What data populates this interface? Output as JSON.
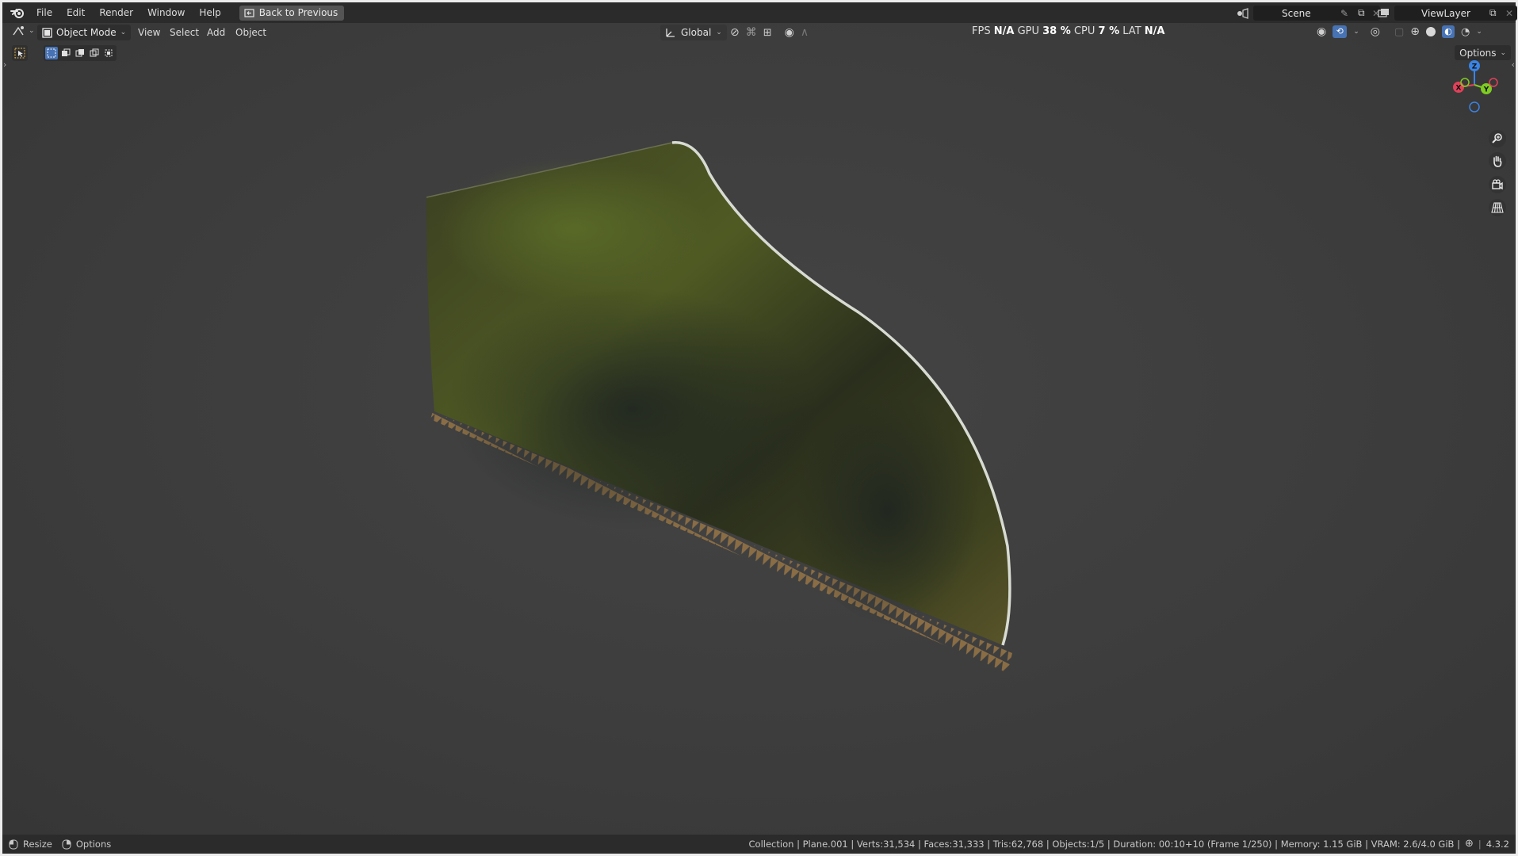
{
  "menubar": {
    "items": [
      "File",
      "Edit",
      "Render",
      "Window",
      "Help"
    ],
    "back_button": "Back to Previous",
    "scene_name": "Scene",
    "view_layer": "ViewLayer"
  },
  "viewport_header": {
    "mode": "Object Mode",
    "menus": [
      "View",
      "Select",
      "Add",
      "Object"
    ],
    "transform_orientation": "Global",
    "options_label": "Options"
  },
  "perf": {
    "fps_label": "FPS",
    "fps_value": "N/A",
    "gpu_label": "GPU",
    "gpu_value": "38 %",
    "cpu_label": "CPU",
    "cpu_value": "7 %",
    "lat_label": "LAT",
    "lat_value": "N/A"
  },
  "gizmo": {
    "z": "Z",
    "y": "Y",
    "x": "X"
  },
  "statusbar": {
    "resize_label": "Resize",
    "options_label": "Options",
    "info": "Collection | Plane.001 | Verts:31,534 | Faces:31,333 | Tris:62,768 | Objects:1/5 | Duration: 00:10+10 (Frame 1/250) | Memory: 1.15 GiB | VRAM: 2.6/4.0 GiB |",
    "version": "4.3.2"
  },
  "colors": {
    "accent_blue": "#4772b3",
    "axis_x": "#e2415a",
    "axis_y": "#7fcc22",
    "axis_z": "#3b83e4"
  }
}
